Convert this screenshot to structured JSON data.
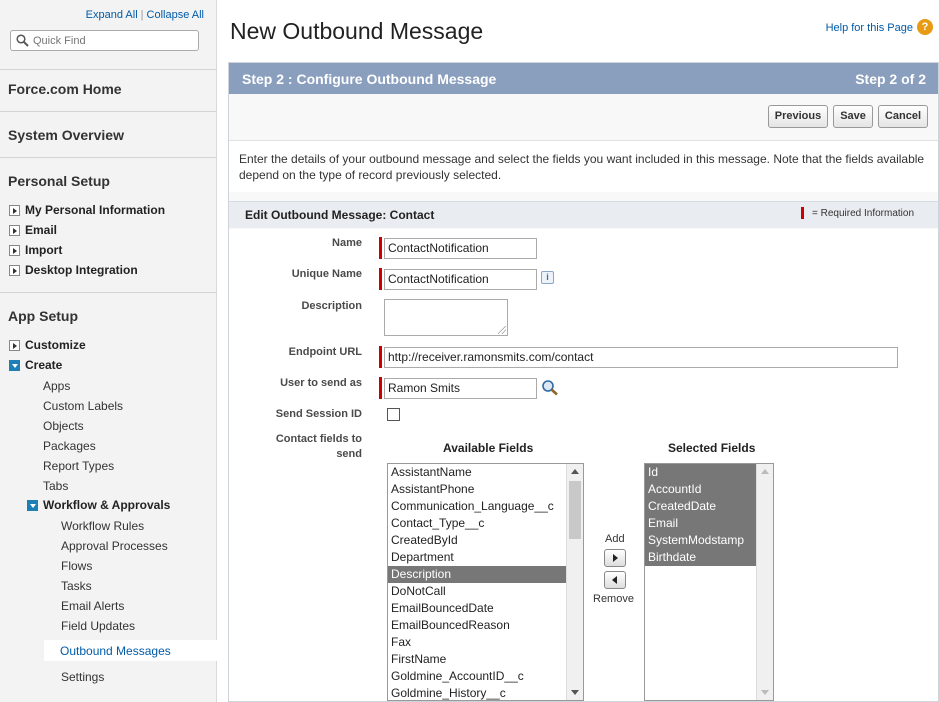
{
  "sidebar": {
    "expand_all": "Expand All",
    "separator": "|",
    "collapse_all": "Collapse All",
    "quick_find_placeholder": "Quick Find",
    "force_home": "Force.com Home",
    "system_overview": "System Overview",
    "personal_setup": {
      "title": "Personal Setup",
      "items": [
        "My Personal Information",
        "Email",
        "Import",
        "Desktop Integration"
      ]
    },
    "app_setup": {
      "title": "App Setup",
      "customize": "Customize",
      "create": "Create",
      "create_items": [
        "Apps",
        "Custom Labels",
        "Objects",
        "Packages",
        "Report Types",
        "Tabs"
      ],
      "workflow": "Workflow & Approvals",
      "workflow_items": [
        "Workflow Rules",
        "Approval Processes",
        "Flows",
        "Tasks",
        "Email Alerts",
        "Field Updates",
        "Outbound Messages"
      ],
      "settings": "Settings"
    }
  },
  "header": {
    "title": "New Outbound Message",
    "help_link": "Help for this Page",
    "help_icon": "?"
  },
  "step": {
    "left": "Step 2 : Configure Outbound Message",
    "right": "Step 2 of 2"
  },
  "buttons": {
    "previous": "Previous",
    "save": "Save",
    "cancel": "Cancel"
  },
  "intro": "Enter the details of your outbound message and select the fields you want included in this message. Note that the fields available depend on the type of record previously selected.",
  "section": {
    "title": "Edit Outbound Message: Contact",
    "required_info": "= Required Information"
  },
  "form": {
    "name_label": "Name",
    "name_value": "ContactNotification",
    "unique_name_label": "Unique Name",
    "unique_name_value": "ContactNotification",
    "info_icon": "i",
    "description_label": "Description",
    "description_value": "",
    "endpoint_label": "Endpoint URL",
    "endpoint_value": "http://receiver.ramonsmits.com/contact",
    "user_label": "User to send as",
    "user_value": "Ramon Smits",
    "session_label": "Send Session ID",
    "session_checked": false,
    "fields_label_1": "Contact fields to",
    "fields_label_2": "send"
  },
  "available": {
    "title": "Available Fields",
    "items": [
      "AssistantName",
      "AssistantPhone",
      "Communication_Language__c",
      "Contact_Type__c",
      "CreatedById",
      "Department",
      "Description",
      "DoNotCall",
      "EmailBouncedDate",
      "EmailBouncedReason",
      "Fax",
      "FirstName",
      "Goldmine_AccountID__c",
      "Goldmine_History__c"
    ],
    "highlighted": "Description"
  },
  "selected": {
    "title": "Selected Fields",
    "items": [
      "Id",
      "AccountId",
      "CreatedDate",
      "Email",
      "SystemModstamp",
      "Birthdate"
    ]
  },
  "mover": {
    "add": "Add",
    "remove": "Remove"
  },
  "colors": {
    "step_bar": "#8a9ebe",
    "required": "#cc0000",
    "link": "#015ba7",
    "selected_item": "#777777"
  }
}
